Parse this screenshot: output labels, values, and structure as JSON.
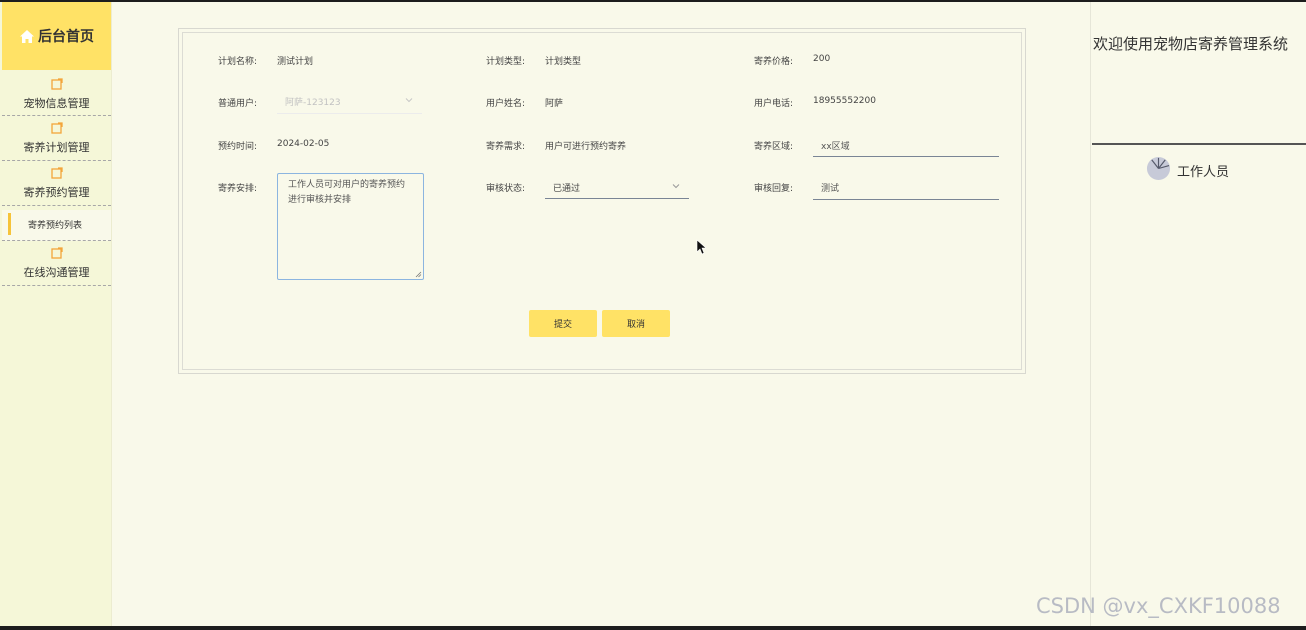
{
  "sidebar": {
    "home_label": "后台首页",
    "items": [
      {
        "label": "宠物信息管理",
        "icon": "edit-icon"
      },
      {
        "label": "寄养计划管理",
        "icon": "edit-icon"
      },
      {
        "label": "寄养预约管理",
        "icon": "edit-icon"
      },
      {
        "label": "在线沟通管理",
        "icon": "edit-icon"
      }
    ],
    "sub_item": "寄养预约列表"
  },
  "form": {
    "plan_name": {
      "label": "计划名称:",
      "value": "测试计划"
    },
    "plan_type": {
      "label": "计划类型:",
      "value": "计划类型"
    },
    "price": {
      "label": "寄养价格:",
      "value": "200"
    },
    "user": {
      "label": "普通用户:",
      "value": "阿萨-123123"
    },
    "user_name": {
      "label": "用户姓名:",
      "value": "阿萨"
    },
    "phone": {
      "label": "用户电话:",
      "value": "18955552200"
    },
    "time": {
      "label": "预约时间:",
      "value": "2024-02-05"
    },
    "need": {
      "label": "寄养需求:",
      "value": "用户可进行预约寄养"
    },
    "area": {
      "label": "寄养区域:",
      "value": "xx区域"
    },
    "arrange": {
      "label": "寄养安排:",
      "value": "工作人员可对用户的寄养预约进行审核并安排"
    },
    "status": {
      "label": "审核状态:",
      "value": "已通过"
    },
    "reply": {
      "label": "审核回复:",
      "value": "测试"
    }
  },
  "buttons": {
    "submit": "提交",
    "cancel": "取消"
  },
  "header": {
    "welcome": "欢迎使用宠物店寄养管理系统",
    "role": "工作人员"
  },
  "watermark": "CSDN @vx_CXKF10088",
  "colors": {
    "accent": "#ffe266",
    "background": "#f9f9ea",
    "sidebar": "#f5f7d8"
  }
}
